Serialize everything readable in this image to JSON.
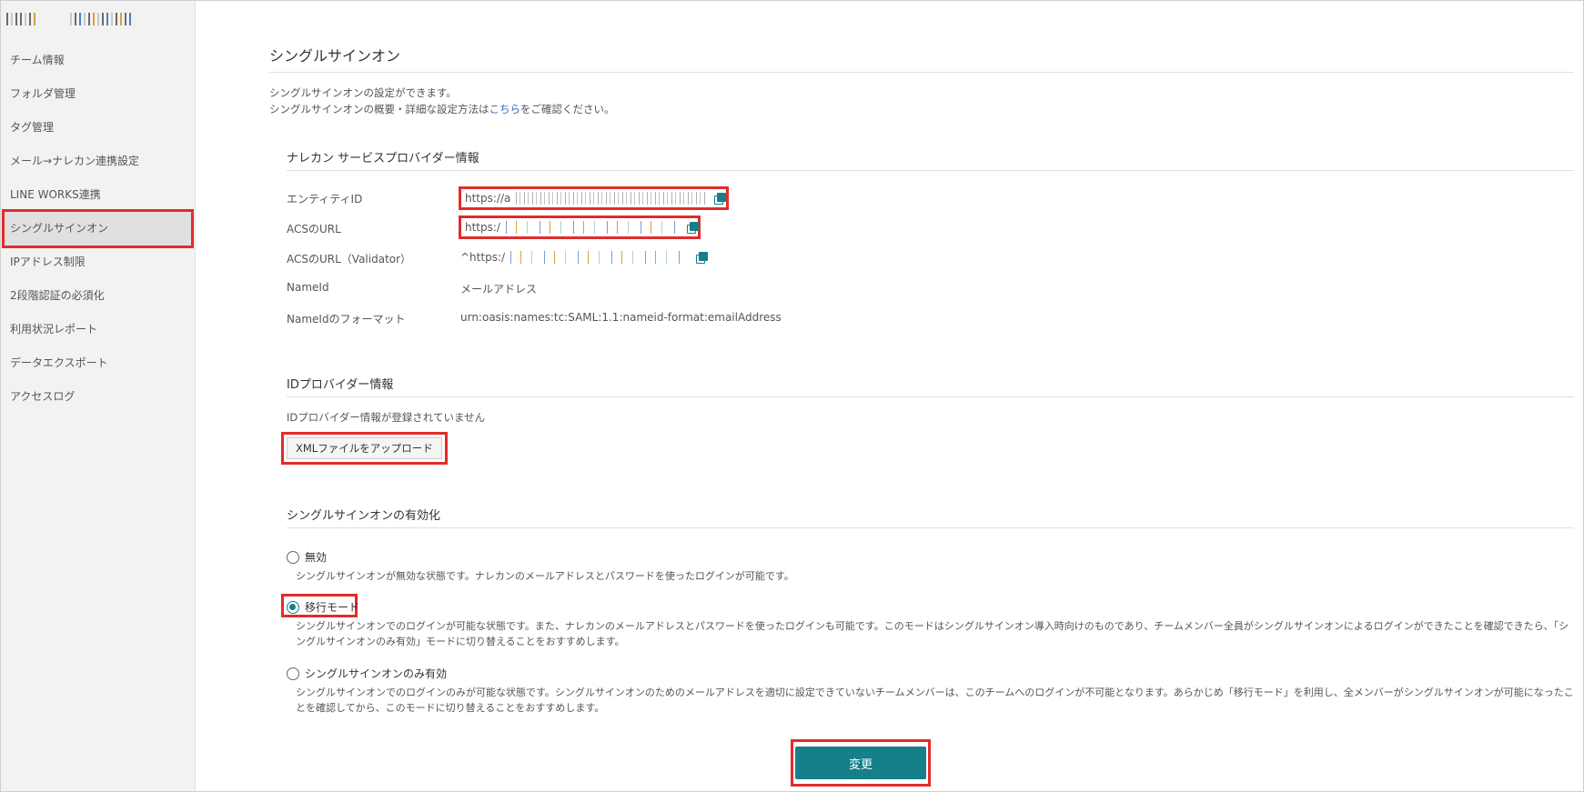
{
  "sidebar": {
    "items": [
      {
        "label": "チーム情報"
      },
      {
        "label": "フォルダ管理"
      },
      {
        "label": "タグ管理"
      },
      {
        "label": "メール→ナレカン連携設定"
      },
      {
        "label": "LINE WORKS連携"
      },
      {
        "label": "シングルサインオン",
        "active": true
      },
      {
        "label": "IPアドレス制限"
      },
      {
        "label": "2段階認証の必須化"
      },
      {
        "label": "利用状況レポート"
      },
      {
        "label": "データエクスポート"
      },
      {
        "label": "アクセスログ"
      }
    ]
  },
  "page": {
    "title": "シングルサインオン",
    "intro_line1": "シングルサインオンの設定ができます。",
    "intro_line2_prefix": "シングルサインオンの概要・詳細な設定方法は",
    "intro_link": "こちら",
    "intro_line2_suffix": "をご確認ください。"
  },
  "sp_info": {
    "title": "ナレカン サービスプロバイダー情報",
    "entity_id_label": "エンティティID",
    "entity_id_value": "https://a",
    "acs_url_label": "ACSのURL",
    "acs_url_value": "https:/",
    "acs_validator_label": "ACSのURL（Validator）",
    "acs_validator_value": "^https:/",
    "nameid_label": "NameId",
    "nameid_value": "メールアドレス",
    "nameid_format_label": "NameIdのフォーマット",
    "nameid_format_value": "urn:oasis:names:tc:SAML:1.1:nameid-format:emailAddress"
  },
  "idp_info": {
    "title": "IDプロバイダー情報",
    "status": "IDプロバイダー情報が登録されていません",
    "upload_label": "XMLファイルをアップロード"
  },
  "sso_mode": {
    "title": "シングルサインオンの有効化",
    "options": [
      {
        "label": "無効",
        "desc": "シングルサインオンが無効な状態です。ナレカンのメールアドレスとパスワードを使ったログインが可能です。",
        "checked": false
      },
      {
        "label": "移行モード",
        "desc": "シングルサインオンでのログインが可能な状態です。また、ナレカンのメールアドレスとパスワードを使ったログインも可能です。このモードはシングルサインオン導入時向けのものであり、チームメンバー全員がシングルサインオンによるログインができたことを確認できたら、「シングルサインオンのみ有効」モードに切り替えることをおすすめします。",
        "checked": true
      },
      {
        "label": "シングルサインオンのみ有効",
        "desc": "シングルサインオンでのログインのみが可能な状態です。シングルサインオンのためのメールアドレスを適切に設定できていないチームメンバーは、このチームへのログインが不可能となります。あらかじめ「移行モード」を利用し、全メンバーがシングルサインオンが可能になったことを確認してから、このモードに切り替えることをおすすめします。",
        "checked": false
      }
    ],
    "submit_label": "変更"
  },
  "colors": {
    "accent": "#157f8a",
    "highlight": "#e32b2b",
    "link": "#2b6fb6"
  }
}
